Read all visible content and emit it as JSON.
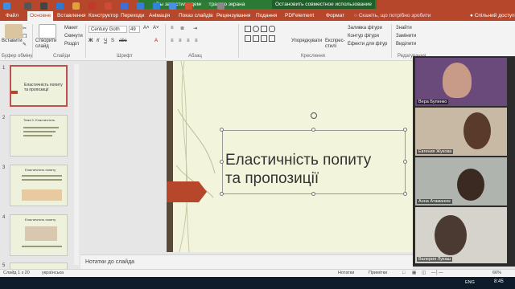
{
  "share_banner": {
    "message": "Вы запустили демонстрацию экрана",
    "stop_label": "Остановить совместное использование"
  },
  "tabs": [
    {
      "label": "Файл"
    },
    {
      "label": "Основне"
    },
    {
      "label": "Вставлення"
    },
    {
      "label": "Конструктор"
    },
    {
      "label": "Переходи"
    },
    {
      "label": "Анімація"
    },
    {
      "label": "Показ слайдів"
    },
    {
      "label": "Рецензування"
    },
    {
      "label": "Подання"
    },
    {
      "label": "PDFelement"
    },
    {
      "label": "Формат"
    }
  ],
  "search": {
    "label": "Скажіть, що потрібно зробити"
  },
  "shared_access": "Спільний доступ",
  "ribbon": {
    "paste": "Вставити",
    "clipboard_group": "Буфер обміну",
    "new_slide": "Створити слайд",
    "layout": "Макет",
    "reset": "Скинути",
    "section": "Розділ",
    "slides_group": "Слайди",
    "font_name": "Century Goth",
    "font_size": "49",
    "font_group": "Шрифт",
    "paragraph_group": "Абзац",
    "arrange": "Упорядкувати",
    "quick_styles": "Експрес-стилі",
    "drawing_group": "Креслення",
    "fill": "Заливка фігури",
    "outline": "Контур фігури",
    "effects": "Ефекти для фігур",
    "find": "Знайти",
    "replace": "Замінити",
    "select": "Виділити",
    "editing_group": "Редагування"
  },
  "thumbnails": [
    {
      "num": "1",
      "text": "Еластичність попиту та пропозиції"
    },
    {
      "num": "2",
      "text": "Тема 9. Еластичність"
    },
    {
      "num": "3",
      "text": "Еластичність попиту"
    },
    {
      "num": "4",
      "text": "Еластичність попиту"
    },
    {
      "num": "5",
      "text": ""
    }
  ],
  "slide": {
    "title_line1": "Еластичність попиту",
    "title_line2": "та пропозиції"
  },
  "notes_placeholder": "Нотатки до слайда",
  "participants": [
    {
      "name": "Вера Буленко"
    },
    {
      "name": "Евгения Жукова"
    },
    {
      "name": "Анна Атаманюк"
    },
    {
      "name": "Валерия Лукаш"
    }
  ],
  "status": {
    "slide_counter": "Слайд 1 з 20",
    "language": "українська",
    "notes": "Нотатки",
    "comments": "Примітки",
    "zoom": "66%"
  },
  "taskbar": {
    "lang": "ENG",
    "time": "8:45"
  },
  "colors": {
    "accent": "#b7472a",
    "banner": "#2a7a36"
  }
}
